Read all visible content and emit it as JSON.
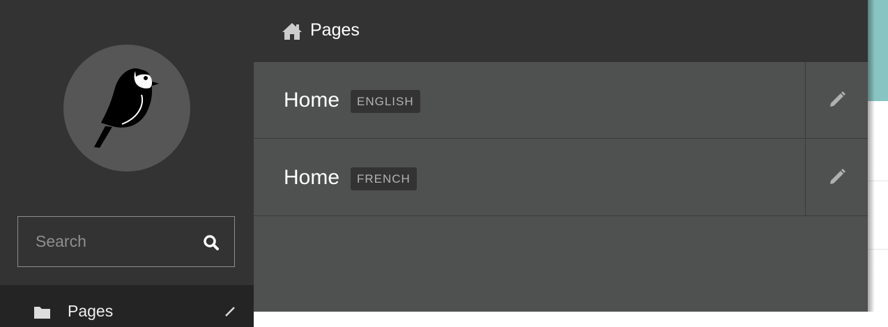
{
  "app": {
    "logo_icon": "wagtail-bird-logo",
    "colors": {
      "sidebar_bg": "#333333",
      "panel_bg": "#4f5150",
      "teal_accent": "#88c4c1"
    }
  },
  "sidebar": {
    "search": {
      "placeholder": "Search",
      "icon": "search-icon"
    },
    "nav_items": [
      {
        "label": "Pages",
        "icon": "folder-icon",
        "expand_icon": "chevron-icon"
      }
    ]
  },
  "explorer": {
    "header": {
      "icon": "home-icon",
      "title": "Pages"
    },
    "rows": [
      {
        "title": "Home",
        "locale": "ENGLISH",
        "edit_icon": "pencil-icon"
      },
      {
        "title": "Home",
        "locale": "FRENCH",
        "edit_icon": "pencil-icon"
      }
    ]
  }
}
